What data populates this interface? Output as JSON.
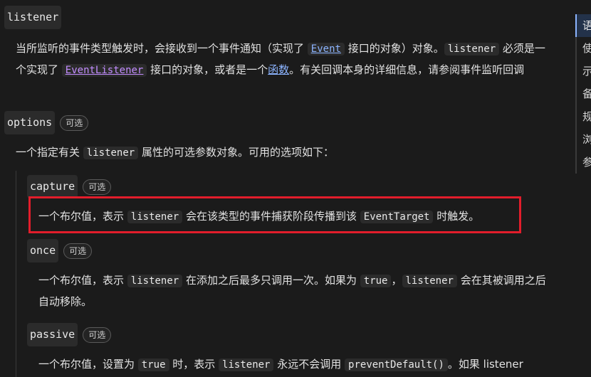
{
  "params": {
    "listener": {
      "name": "listener",
      "desc_part1": "当所监听的事件类型触发时，会接收到一个事件通知（实现了 ",
      "event_link": "Event",
      "desc_part2": " 接口的对象）对象。",
      "listener_code": "listener",
      "desc_part3": " 必须是一个实现了 ",
      "eventlistener_link": "EventListener",
      "desc_part4": " 接口的对象，或者是一个",
      "function_link": "函数",
      "desc_part5": "。有关回调本身的详细信息，请参阅事件监听回调"
    },
    "options": {
      "name": "options",
      "badge": "可选",
      "desc_part1": "一个指定有关 ",
      "listener_code": "listener",
      "desc_part2": " 属性的可选参数对象。可用的选项如下："
    },
    "capture": {
      "name": "capture",
      "badge": "可选",
      "desc_part1": "一个布尔值，表示 ",
      "listener_code": "listener",
      "desc_part2": " 会在该类型的事件捕获阶段传播到该 ",
      "target_code": "EventTarget",
      "desc_part3": " 时触发。"
    },
    "once": {
      "name": "once",
      "badge": "可选",
      "desc_part1": "一个布尔值，表示 ",
      "listener_code": "listener",
      "desc_part2": " 在添加之后最多只调用一次。如果为 ",
      "true_code": "true",
      "desc_part3": "，",
      "listener_code2": "listener",
      "desc_part4": " 会在其被调用之后自动移除。"
    },
    "passive": {
      "name": "passive",
      "badge": "可选",
      "desc_part1": "一个布尔值，设置为 ",
      "true_code": "true",
      "desc_part2": " 时，表示 ",
      "listener_code": "listener",
      "desc_part3": " 永远不会调用 ",
      "pd_code": "preventDefault()",
      "desc_part4": "。如果 listener"
    }
  },
  "toc": {
    "items": [
      "语",
      "使",
      "示",
      "备",
      "规",
      "浏",
      "参"
    ]
  }
}
